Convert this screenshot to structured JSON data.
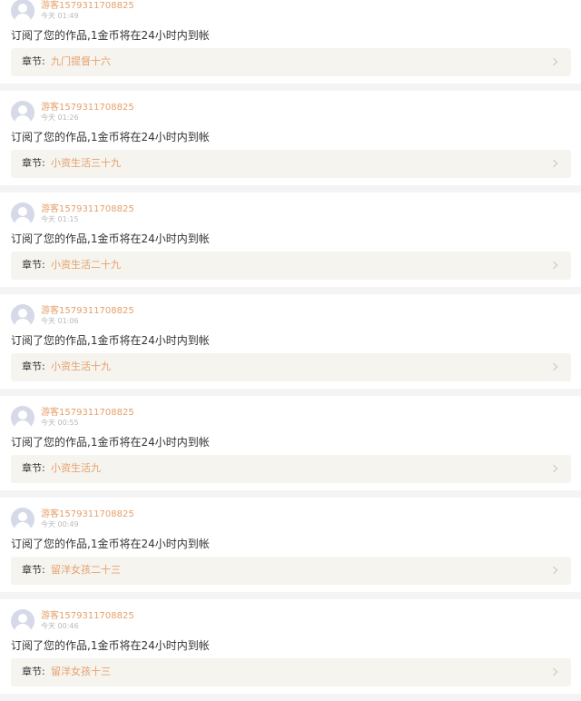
{
  "labels": {
    "chapter_label": "章节:"
  },
  "notifications": [
    {
      "username": "游客1579311708825",
      "time": "今天 01:49",
      "message": "订阅了您的作品,1金币将在24小时内到帐",
      "chapter": "九门提督十六"
    },
    {
      "username": "游客1579311708825",
      "time": "今天 01:26",
      "message": "订阅了您的作品,1金币将在24小时内到帐",
      "chapter": "小资生活三十九"
    },
    {
      "username": "游客1579311708825",
      "time": "今天 01:15",
      "message": "订阅了您的作品,1金币将在24小时内到帐",
      "chapter": "小资生活二十九"
    },
    {
      "username": "游客1579311708825",
      "time": "今天 01:06",
      "message": "订阅了您的作品,1金币将在24小时内到帐",
      "chapter": "小资生活十九"
    },
    {
      "username": "游客1579311708825",
      "time": "今天 00:55",
      "message": "订阅了您的作品,1金币将在24小时内到帐",
      "chapter": "小资生活九"
    },
    {
      "username": "游客1579311708825",
      "time": "今天 00:49",
      "message": "订阅了您的作品,1金币将在24小时内到帐",
      "chapter": "留洋女孩二十三"
    },
    {
      "username": "游客1579311708825",
      "time": "今天 00:46",
      "message": "订阅了您的作品,1金币将在24小时内到帐",
      "chapter": "留洋女孩十三"
    }
  ],
  "colors": {
    "accent": "#e6a06a",
    "text": "#333333",
    "muted": "#b9b9b9",
    "chapter_bg": "#f5f4ef",
    "page_bg": "#f4f4f4"
  },
  "icons": {
    "avatar": "user-avatar-icon",
    "chevron": "chevron-right-icon"
  }
}
